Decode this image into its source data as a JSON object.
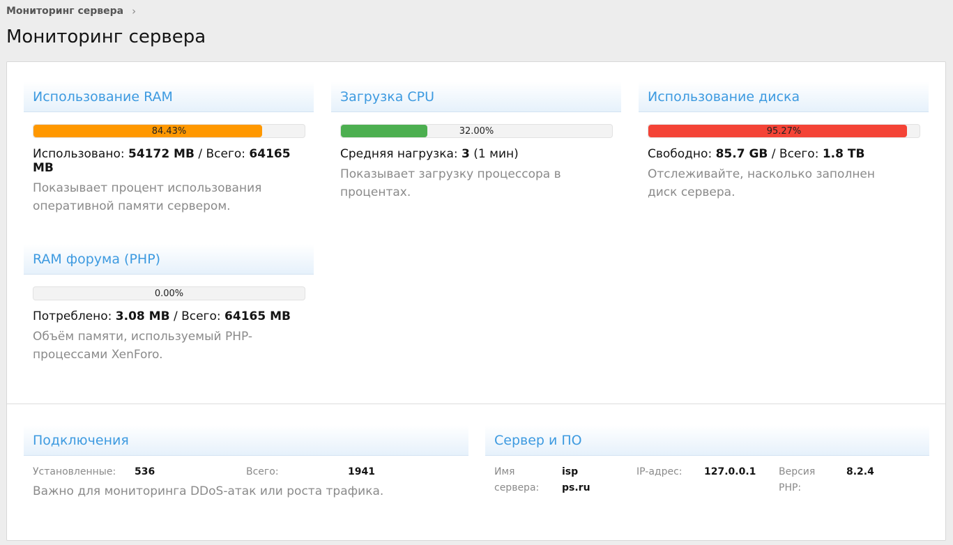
{
  "breadcrumb": {
    "label": "Мониторинг сервера",
    "chevron": "›"
  },
  "page_title": "Мониторинг сервера",
  "colors": {
    "accent": "#3d9ae0",
    "ram_bar": "#ff9800",
    "cpu_bar": "#4caf50",
    "disk_bar": "#f44336"
  },
  "ram": {
    "title": "Использование RAM",
    "percent": 84.43,
    "percent_text": "84.43%",
    "used_label": "Использовано:",
    "used_value": "54172 MB",
    "sep": " / ",
    "total_label": "Всего:",
    "total_value": "64165 MB",
    "desc": "Показывает процент использования оперативной памяти сервером."
  },
  "cpu": {
    "title": "Загрузка CPU",
    "percent": 32.0,
    "percent_text": "32.00%",
    "load_label": "Средняя нагрузка:",
    "load_value": "3",
    "load_suffix": " (1 мин)",
    "desc": "Показывает загрузку процессора в процентах."
  },
  "disk": {
    "title": "Использование диска",
    "percent": 95.27,
    "percent_text": "95.27%",
    "free_label": "Свободно:",
    "free_value": "85.7 GB",
    "sep": " / ",
    "total_label": "Всего:",
    "total_value": "1.8 TB",
    "desc": "Отслеживайте, насколько заполнен диск сервера."
  },
  "php": {
    "title": "RAM форума (PHP)",
    "percent": 0.0,
    "percent_text": "0.00%",
    "used_label": "Потреблено:",
    "used_value": "3.08 MB",
    "sep": " / ",
    "total_label": "Всего:",
    "total_value": "64165 MB",
    "desc": "Объём памяти, используемый PHP-процессами XenForo."
  },
  "connections": {
    "title": "Подключения",
    "established_label": "Установленные:",
    "established_value": "536",
    "total_label": "Всего:",
    "total_value": "1941",
    "desc": "Важно для мониторинга DDoS-атак или роста трафика."
  },
  "server": {
    "title": "Сервер и ПО",
    "name_label_1": "Имя",
    "name_label_2": "сервера:",
    "name_value_1": "isp",
    "name_value_2": "ps.ru",
    "ip_label": "IP-адрес:",
    "ip_value": "127.0.0.1",
    "php_label_1": "Версия",
    "php_label_2": "PHP:",
    "php_value": "8.2.4"
  }
}
